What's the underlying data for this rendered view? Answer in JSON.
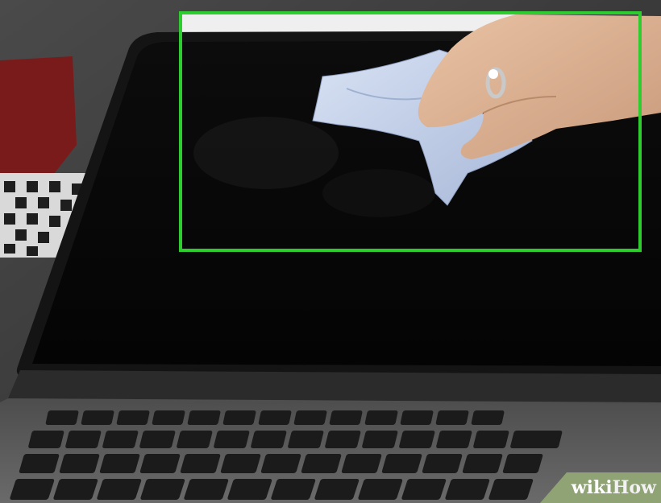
{
  "image": {
    "description_free": true,
    "highlight_color": "#2ecc2e",
    "watermark": {
      "part1": "wiki",
      "part2": "How"
    }
  }
}
